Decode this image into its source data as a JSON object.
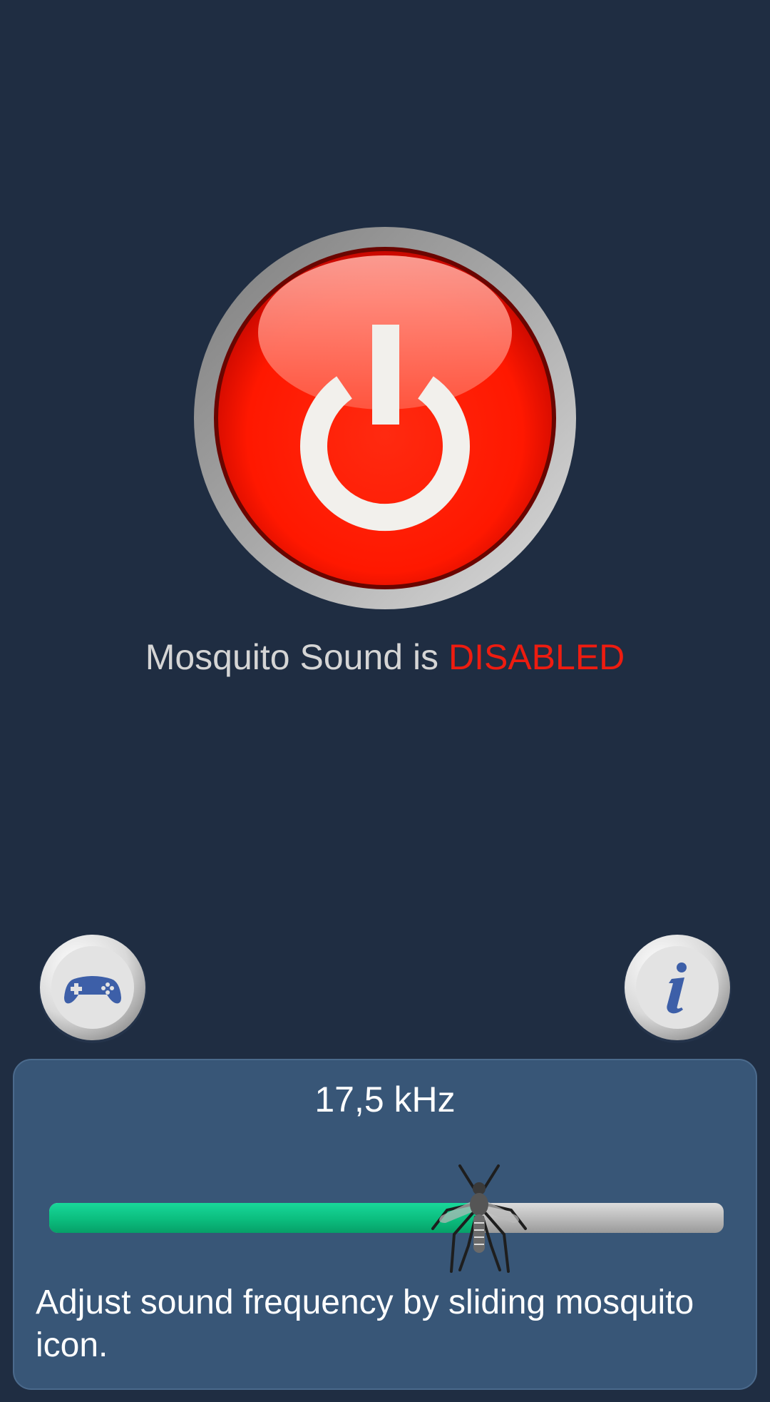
{
  "power_button": {
    "icon": "power-icon",
    "colors": {
      "button": "#ff1a00",
      "ring": "#9a9a9a",
      "symbol": "#f2f0ec"
    }
  },
  "status": {
    "prefix": "Mosquito Sound is",
    "state": "DISABLED",
    "state_color": "#ee1c10"
  },
  "games_button": {
    "icon": "gamepad-icon"
  },
  "info_button": {
    "icon": "info-icon"
  },
  "frequency_panel": {
    "frequency_label": "17,5 kHz",
    "slider": {
      "value_fraction": 0.637,
      "fill_color": "#0bbd7e",
      "thumb_icon": "mosquito-icon"
    },
    "hint": "Adjust sound frequency by sliding mosquito icon."
  }
}
